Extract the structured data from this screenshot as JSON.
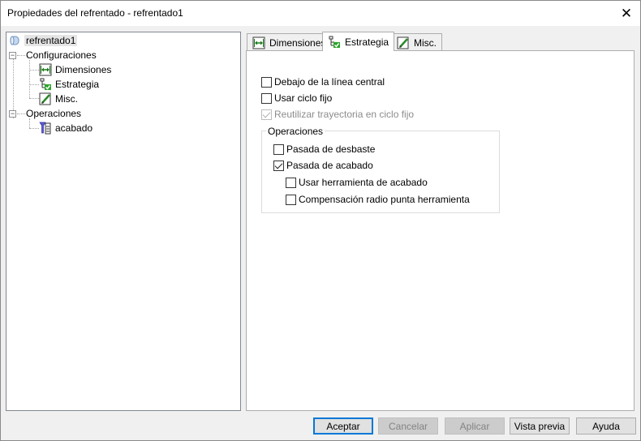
{
  "window": {
    "title": "Propiedades del refrentado - refrentado1"
  },
  "tree": {
    "root": "refrentado1",
    "configuraciones": {
      "label": "Configuraciones",
      "children": [
        "Dimensiones",
        "Estrategia",
        "Misc."
      ]
    },
    "operaciones": {
      "label": "Operaciones",
      "children": [
        "acabado"
      ]
    }
  },
  "tabs": [
    "Dimensiones",
    "Estrategia",
    "Misc."
  ],
  "strategy": {
    "below_centerline": "Debajo de la línea central",
    "use_fixed_cycle": "Usar ciclo fijo",
    "reuse_path": "Reutilizar trayectoria en ciclo fijo",
    "operations_group": "Operaciones",
    "roughing_pass": "Pasada de desbaste",
    "finishing_pass": "Pasada de acabado",
    "use_finishing_tool": "Usar herramienta de acabado",
    "tool_radius_comp": "Compensación radio punta herramienta"
  },
  "buttons": {
    "accept": "Aceptar",
    "cancel": "Cancelar",
    "apply": "Aplicar",
    "preview": "Vista previa",
    "help": "Ayuda"
  },
  "colors": {
    "accent": "#0078d7",
    "tree_line": "#a0a0a0"
  }
}
